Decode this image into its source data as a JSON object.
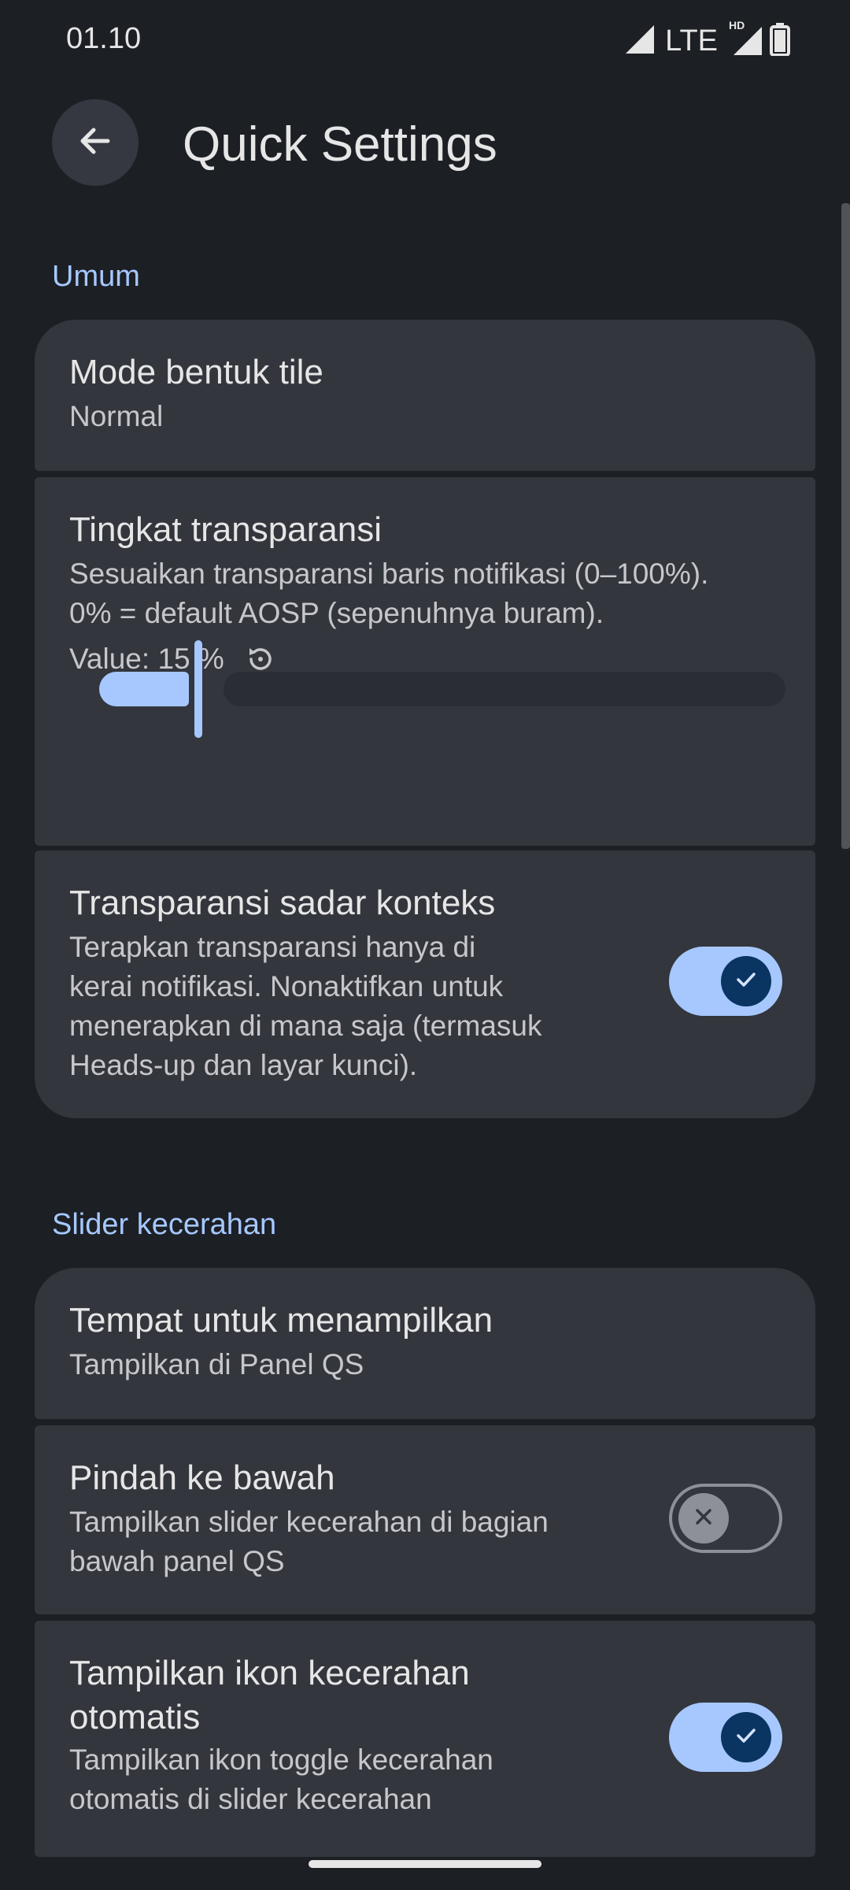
{
  "status_bar": {
    "time": "01.10",
    "network": "LTE",
    "hd_badge": "HD",
    "icons": [
      "signal-icon",
      "signal-hd-icon",
      "battery-icon"
    ]
  },
  "app_bar": {
    "back_icon": "arrow-left-icon",
    "title": "Quick Settings"
  },
  "sections": [
    {
      "header": "Umum",
      "items": [
        {
          "title": "Mode bentuk tile",
          "summary": "Normal"
        },
        {
          "title": "Tingkat transparansi",
          "summary_line1": "Sesuaikan transparansi baris notifikasi (0–100%).",
          "summary_line2": "0% = default AOSP (sepenuhnya buram).",
          "value_label": "Value: 15 %",
          "reset_icon": "reset-icon",
          "slider_value_percent": 15
        },
        {
          "title": "Transparansi sadar konteks",
          "summary_line1": "Terapkan transparansi hanya di",
          "summary_line2": "kerai notifikasi. Nonaktifkan untuk",
          "summary_line3": "menerapkan di mana saja (termasuk",
          "summary_line4": "Heads-up dan layar kunci).",
          "toggle_on": true
        }
      ]
    },
    {
      "header": "Slider kecerahan",
      "items": [
        {
          "title": "Tempat untuk menampilkan",
          "summary": "Tampilkan di Panel QS"
        },
        {
          "title": "Pindah ke bawah",
          "summary_line1": "Tampilkan slider kecerahan di bagian",
          "summary_line2": "bawah panel QS",
          "toggle_on": false
        },
        {
          "title_line1": "Tampilkan ikon kecerahan",
          "title_line2": "otomatis",
          "summary_line1": "Tampilkan ikon toggle kecerahan",
          "summary_line2": "otomatis di slider kecerahan",
          "toggle_on": true
        }
      ]
    }
  ],
  "colors": {
    "background": "#1c1f24",
    "card": "#33363d",
    "accent": "#a6c8ff",
    "toggle_knob_on": "#0a3563",
    "toggle_off": "#8e9099"
  }
}
